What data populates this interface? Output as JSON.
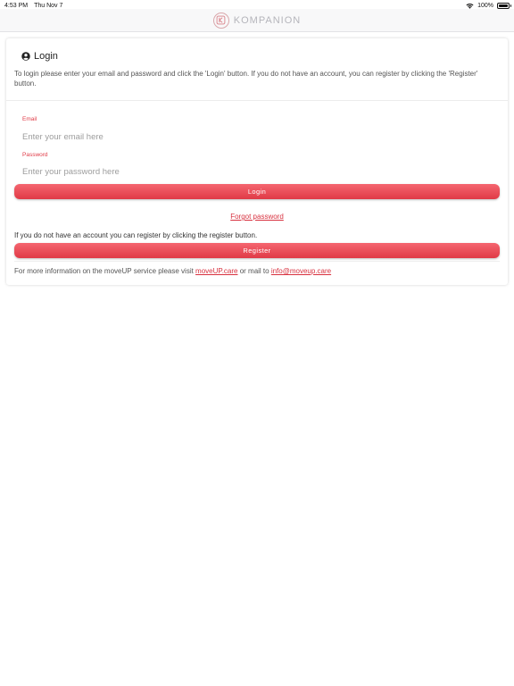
{
  "status_bar": {
    "time": "4:53 PM",
    "date": "Thu Nov 7",
    "battery": "100%",
    "icons": [
      "wifi-icon",
      "battery-icon"
    ]
  },
  "header": {
    "brand": "KOMPANION",
    "logo_icon": "kompanion-logo-icon"
  },
  "login": {
    "title": "Login",
    "title_icon": "user-circle-icon",
    "intro": "To login please enter your email and password and click the 'Login' button. If you do not have an account, you can register by clicking the 'Register' button.",
    "email_label": "Email",
    "email_placeholder": "Enter your email here",
    "email_value": "",
    "password_label": "Password",
    "password_placeholder": "Enter your password here",
    "password_value": "",
    "login_button": "Login",
    "forgot_password": "Forgot password",
    "register_hint": "If you do not have an account you can register by clicking the register button.",
    "register_button": "Register"
  },
  "footer": {
    "prefix": "For more information on the moveUP service please visit ",
    "site_link": "moveUP.care",
    "middle": " or mail to ",
    "mail_link": "info@moveup.care"
  },
  "colors": {
    "accent": "#e03c48",
    "button_top": "#f56670",
    "button_bottom": "#e03a46",
    "header_bg": "#f8f8f9"
  }
}
